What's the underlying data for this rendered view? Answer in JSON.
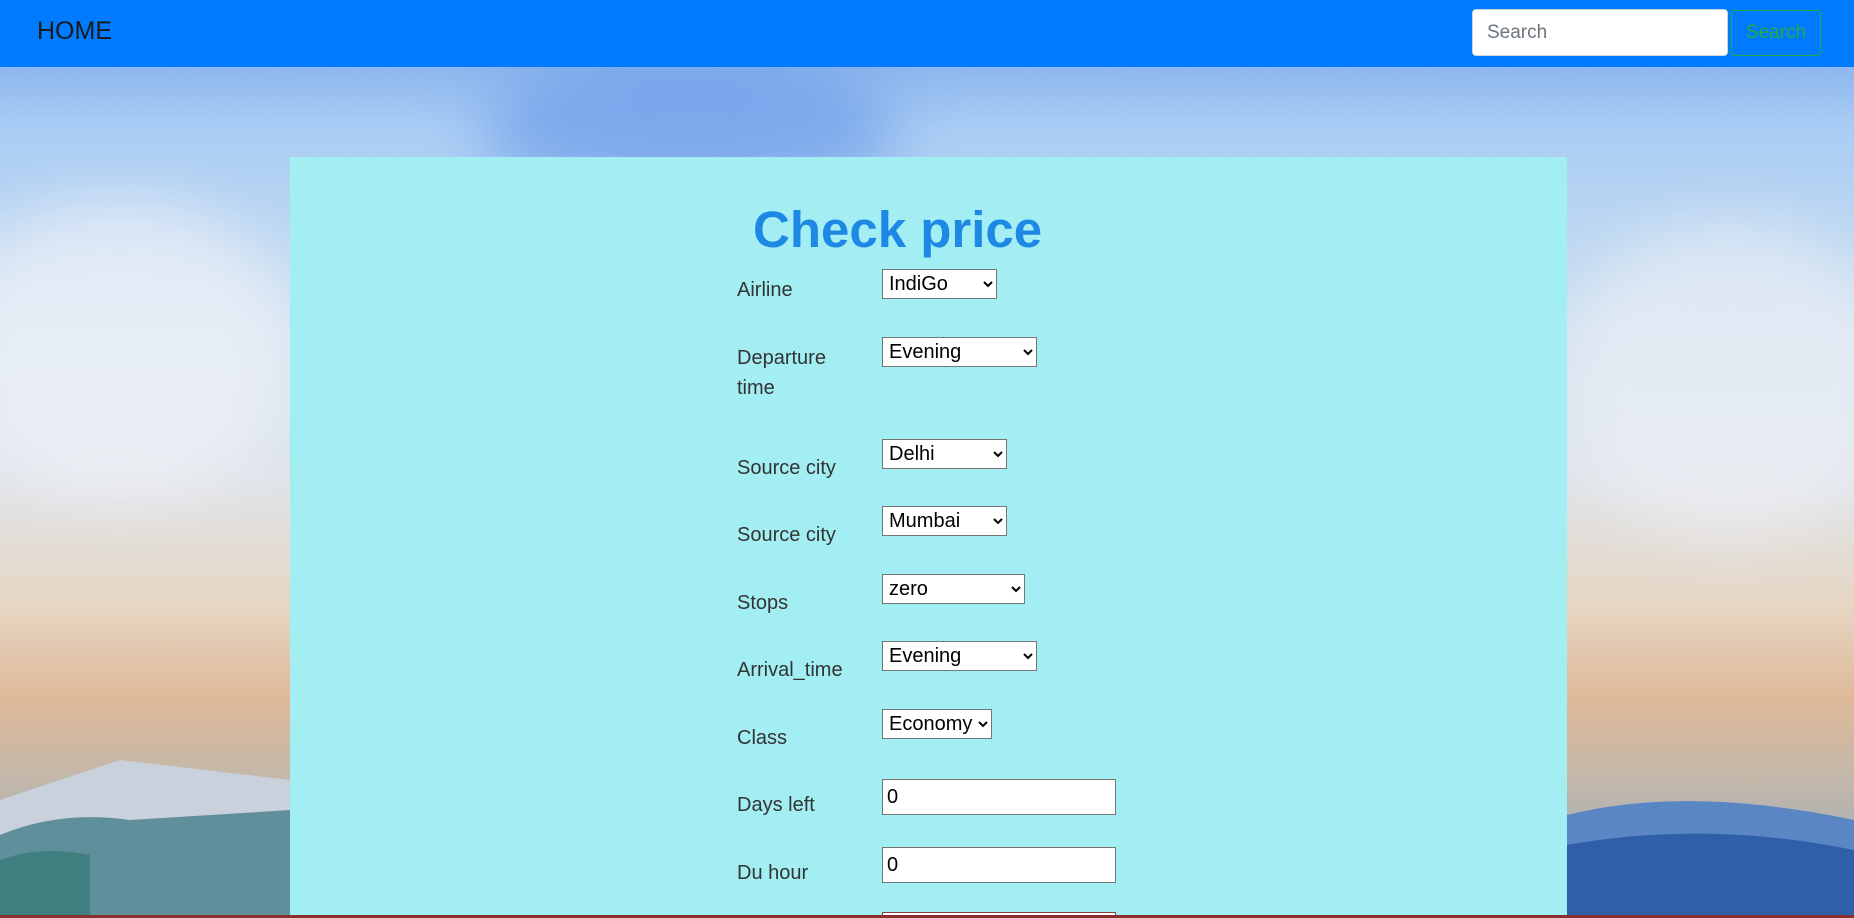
{
  "navbar": {
    "brand": "HOME",
    "search_placeholder": "Search",
    "search_button": "Search"
  },
  "form": {
    "title": "Check price",
    "fields": {
      "airline": {
        "label": "Airline",
        "value": "IndiGo"
      },
      "departure_time": {
        "label_line1": "Departure",
        "label_line2": "time",
        "value": "Evening"
      },
      "source_city": {
        "label": "Source city",
        "value": "Delhi"
      },
      "destination_city": {
        "label": "Source city",
        "value": "Mumbai"
      },
      "stops": {
        "label": "Stops",
        "value": "zero"
      },
      "arrival_time": {
        "label": "Arrival_time",
        "value": "Evening"
      },
      "class": {
        "label": "Class",
        "value": "Economy"
      },
      "days_left": {
        "label": "Days left",
        "value": "0"
      },
      "du_hour": {
        "label": "Du hour",
        "value": "0"
      }
    }
  },
  "colors": {
    "navbar": "#007bff",
    "panel": "#a3eef2",
    "title": "#1e88e5",
    "search_button": "#28a745"
  }
}
